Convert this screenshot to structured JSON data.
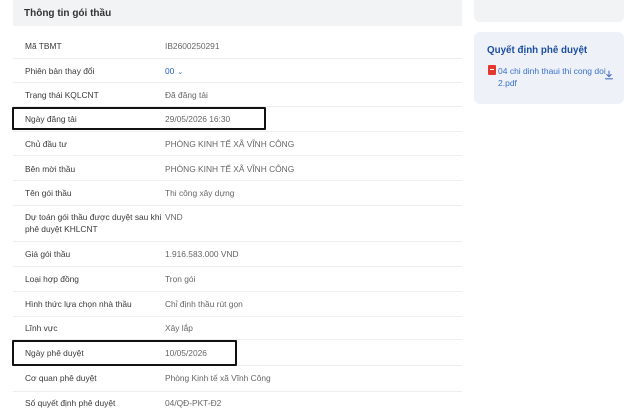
{
  "section": {
    "title": "Thông tin gói thầu"
  },
  "rows": [
    {
      "label": "Mã TBMT",
      "value": "IB2600250291"
    },
    {
      "label": "Phiên bản thay đổi",
      "value": "00"
    },
    {
      "label": "Trạng thái KQLCNT",
      "value": "Đã đăng tải"
    },
    {
      "label": "Ngày đăng tải",
      "value": "29/05/2026 16:30"
    },
    {
      "label": "Chủ đầu tư",
      "value": "PHÒNG KINH TẾ XÃ VĨNH CÔNG"
    },
    {
      "label": "Bên mời thầu",
      "value": "PHÒNG KINH TẾ XÃ VĨNH CÔNG"
    },
    {
      "label": "Tên gói thầu",
      "value": "Thi công xây dựng"
    },
    {
      "label_line1": "Dự toán gói thầu được duyệt sau khi",
      "label_line2": "phê duyệt KHLCNT",
      "value": "VND"
    },
    {
      "label": "Giá gói thầu",
      "value": "1.916.583.000 VND"
    },
    {
      "label": "Loại hợp đồng",
      "value": "Trọn gói"
    },
    {
      "label": "Hình thức lựa chọn nhà thầu",
      "value": "Chỉ định thầu rút gọn"
    },
    {
      "label": "Lĩnh vực",
      "value": "Xây lắp"
    },
    {
      "label": "Ngày phê duyệt",
      "value": "10/05/2026"
    },
    {
      "label": "Cơ quan phê duyệt",
      "value": "Phòng Kinh tế xã Vĩnh Công"
    },
    {
      "label": "Số quyết định phê duyệt",
      "value": "04/QĐ-PKT-Đ2"
    }
  ],
  "sidebar": {
    "card_title": "Quyết định phê duyệt",
    "file_line1": "04 chi dinh thaui thi cong doi",
    "file_line2": "2.pdf"
  },
  "icons": {
    "file": "pdf-icon",
    "download": "download-icon",
    "version_select": "chevron-down-icon"
  },
  "colors": {
    "accent": "#1e5fc7",
    "highlight_border": "#111111",
    "header_bg": "#f2f3f5"
  }
}
